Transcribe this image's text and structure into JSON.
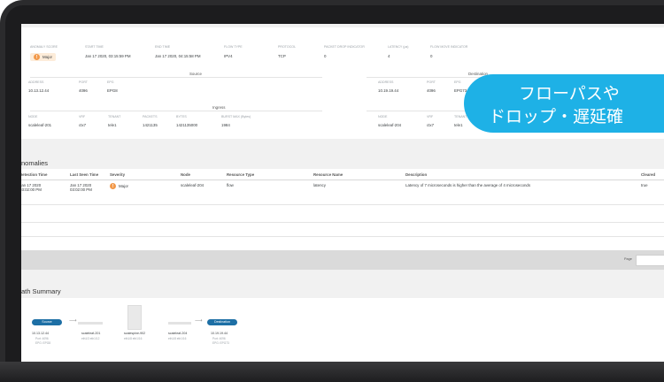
{
  "summary": {
    "fields": [
      {
        "label": "ANOMALY SCORE",
        "value": "Major",
        "is_badge": true
      },
      {
        "label": "START TIME",
        "value": "Jan 17 2020, 03:15:59 PM"
      },
      {
        "label": "END TIME",
        "value": "Jan 17 2020, 04:15:58 PM"
      },
      {
        "label": "FLOW TYPE",
        "value": "IPV4"
      },
      {
        "label": "PROTOCOL",
        "value": "TCP"
      },
      {
        "label": "PACKET DROP INDICATOR",
        "value": "0"
      },
      {
        "label": "LATENCY (µs)",
        "value": "4"
      },
      {
        "label": "FLOW MOVE INDICATOR",
        "value": "0"
      }
    ],
    "source_title": "Source",
    "destination_title": "Destination",
    "source": [
      {
        "label": "ADDRESS",
        "value": "10.13.12.44"
      },
      {
        "label": "PORT",
        "value": "4096"
      },
      {
        "label": "EPG",
        "value": "EPG8"
      }
    ],
    "destination": [
      {
        "label": "ADDRESS",
        "value": "10.19.19.44"
      },
      {
        "label": "PORT",
        "value": "4096"
      },
      {
        "label": "EPG",
        "value": "EPG73"
      }
    ],
    "ingress_title": "Ingress",
    "ingress": [
      {
        "label": "NODE",
        "value": "scaleleaf-201"
      },
      {
        "label": "VRF",
        "value": "ctx7"
      },
      {
        "label": "TENANT",
        "value": "tele1"
      },
      {
        "label": "PACKETS",
        "value": "1421135"
      },
      {
        "label": "BYTES",
        "value": "1421135000"
      },
      {
        "label": "BURST MAX (Bytes)",
        "value": "1984"
      }
    ],
    "egress": [
      {
        "label": "NODE",
        "value": "scaleleaf-204"
      },
      {
        "label": "VRF",
        "value": "ctx7"
      },
      {
        "label": "TENANT",
        "value": "tele1"
      }
    ]
  },
  "anomalies": {
    "title": "Anomalies",
    "columns": [
      "Detection Time",
      "Last Seen Time",
      "Severity",
      "Node",
      "Resource Type",
      "Resource Name",
      "Description",
      "Cleared"
    ],
    "rows": [
      {
        "detection": "Jan 17 2020 03:02:00 PM",
        "last_seen": "Jan 17 2020 03:02:00 PM",
        "severity": "Major",
        "node": "scaleleaf-204",
        "resource_type": "flow",
        "resource_name": "latency",
        "description": "Latency of 7 microseconds is higher than the average of 4 microseconds",
        "cleared": "true"
      }
    ],
    "page_label": "Page"
  },
  "path": {
    "title": "Path Summary",
    "source_pill": "Source",
    "destination_pill": "Destination",
    "source_ip": "10.13.12.44",
    "source_sub1": "Port: 4096",
    "source_sub2": "EPG: EPG8",
    "nodes": [
      {
        "name": "scaleleaf-201",
        "sub": "eth1/3 eth1/12"
      },
      {
        "name": "scalespine-902",
        "sub": "eth1/8 eth1/16"
      },
      {
        "name": "scaleleaf-204",
        "sub": "eth1/8 eth1/16"
      }
    ],
    "dest_ip": "10.19.19.44",
    "dest_sub1": "Port: 4096",
    "dest_sub2": "EPG: EPG73"
  },
  "callout": {
    "line1": "フローパスや",
    "line2": "ドロップ・遅延確"
  },
  "colors": {
    "accent": "#1eb1e6",
    "severity_major": "#f2994a",
    "path_pill": "#1d6fa5"
  }
}
